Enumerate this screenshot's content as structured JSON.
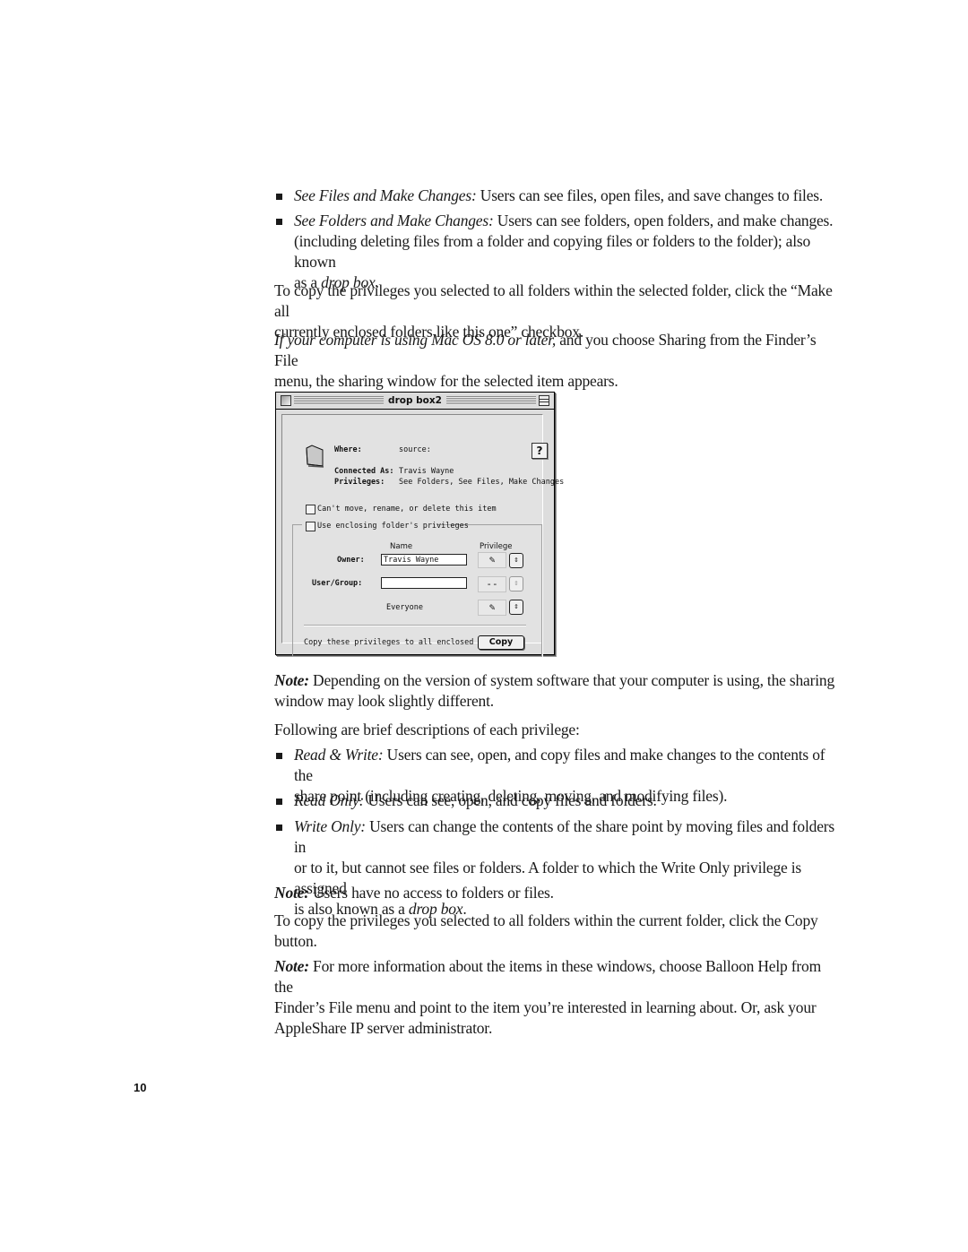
{
  "bullets_top": [
    {
      "term": "See Files and Make Changes:",
      "text": " Users can see files, open files, and save changes to files."
    },
    {
      "term": "See Folders and Make Changes:",
      "text": " Users can see folders, open folders, and make changes.",
      "line2": "(including deleting files from a folder and copying files or folders to the folder); also known",
      "line3_pre": "as a ",
      "line3_em": "drop box",
      "line3_post": "."
    }
  ],
  "para_copy": {
    "line1": "To copy the privileges you selected to all folders within the selected folder, click the “Make all",
    "line2": "currently enclosed folders like this one” checkbox."
  },
  "para_macos": {
    "em": "If your computer is using Mac OS 8.0 or later,",
    "line1": " and you choose Sharing from the Finder’s File",
    "line2": "menu, the sharing window for the selected item appears."
  },
  "window": {
    "title": "drop box2",
    "where_label": "Where:",
    "where_value": "source:",
    "connected_label": "Connected As:",
    "connected_value": "Travis Wayne",
    "privileges_label": "Privileges:",
    "privileges_value": "See Folders, See Files, Make Changes",
    "help_glyph": "?",
    "cant_move_label": "Can't move, rename, or delete this item",
    "use_enclosing_label": "Use enclosing folder's privileges",
    "col_name": "Name",
    "col_privilege": "Privilege",
    "owner_label": "Owner:",
    "owner_value": "Travis Wayne",
    "usergroup_label": "User/Group:",
    "usergroup_value": "",
    "usergroup_priv": "--",
    "everyone_label": "Everyone",
    "copy_label": "Copy these privileges to all enclosed folders",
    "copy_button": "Copy",
    "icons": {
      "folder": "folder-icon",
      "help": "help-icon",
      "privilege": "pencil-glasses-icon",
      "arrows": "up-down-arrows-icon"
    }
  },
  "note1": {
    "label": "Note:",
    "line1": "  Depending on the version of system software that your computer is using, the sharing",
    "line2": "window may look slightly different."
  },
  "following": "Following are brief descriptions of each privilege:",
  "bullets_priv": [
    {
      "term": "Read & Write:",
      "line1": "  Users can see, open, and copy files and make changes to the contents of the",
      "line2": "share point (including creating, deleting, moving, and modifying files)."
    },
    {
      "term": "Read Only:",
      "line1": "  Users can see, open, and copy files and folders."
    },
    {
      "term": "Write Only:",
      "line1": "  Users can change the contents of the share point by moving files and folders in",
      "line2": "or to it, but cannot see files or folders. A folder to which the Write Only privilege is assigned",
      "line3_pre": "is also known as a ",
      "line3_em": "drop box",
      "line3_post": "."
    }
  ],
  "note2": {
    "label": "Note:",
    "text": "  Users have no access to folders or files."
  },
  "para_copy2": {
    "line1": "To copy the privileges you selected to all folders within the current folder, click the Copy",
    "line2": "button."
  },
  "note3": {
    "label": "Note:",
    "line1": "  For more information about the items in these windows, choose Balloon Help from the",
    "line2": "Finder’s File menu and point to the item you’re interested in learning about. Or, ask your",
    "line3": "AppleShare IP server administrator."
  },
  "page_number": "10"
}
